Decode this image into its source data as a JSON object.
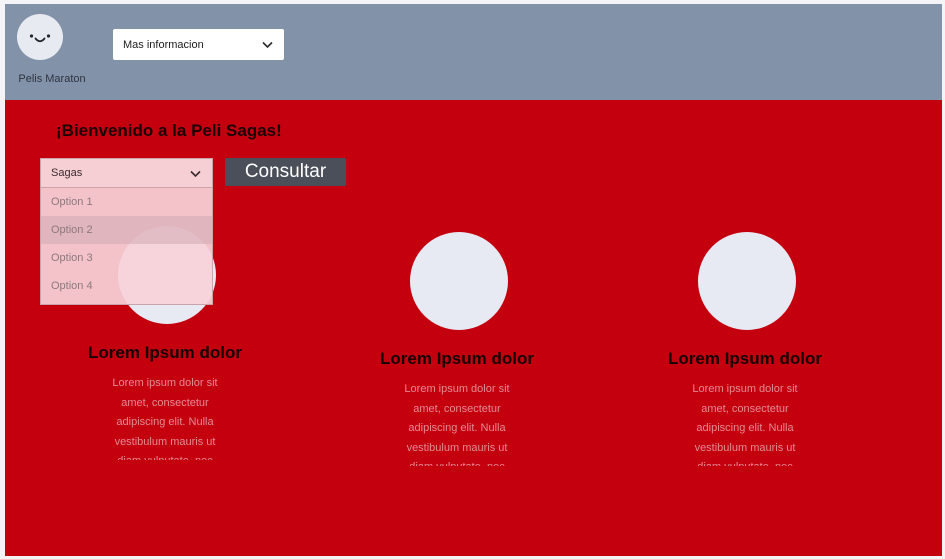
{
  "header": {
    "logo_label": "Pelis Maraton",
    "nav_select": "Mas informacion"
  },
  "main": {
    "welcome": "¡Bienvenido a la Peli Sagas!",
    "saga_select": {
      "value": "Sagas",
      "options": [
        "Option 1",
        "Option 2",
        "Option 3",
        "Option 4"
      ]
    },
    "consult_button": "Consultar",
    "cards": [
      {
        "title": "Lorem Ipsum dolor",
        "text": "Lorem ipsum dolor sit amet, consectetur adipiscing elit. Nulla vestibulum mauris ut diam vulputate, nec"
      },
      {
        "title": "Lorem Ipsum dolor",
        "text": "Lorem ipsum dolor sit amet, consectetur adipiscing elit. Nulla vestibulum mauris ut diam vulputate, nec"
      },
      {
        "title": "Lorem Ipsum dolor",
        "text": "Lorem ipsum dolor sit amet, consectetur adipiscing elit. Nulla vestibulum mauris ut diam vulputate, nec"
      }
    ]
  },
  "colors": {
    "page_background": "#c4000f",
    "header_background": "#8292a8",
    "button_background": "#4a4f59",
    "card_image": "#e7e9f3",
    "select_background": "#f6cfd5"
  },
  "icons": {
    "logo": "smiley-face-icon",
    "dropdown": "chevron-down-icon"
  }
}
